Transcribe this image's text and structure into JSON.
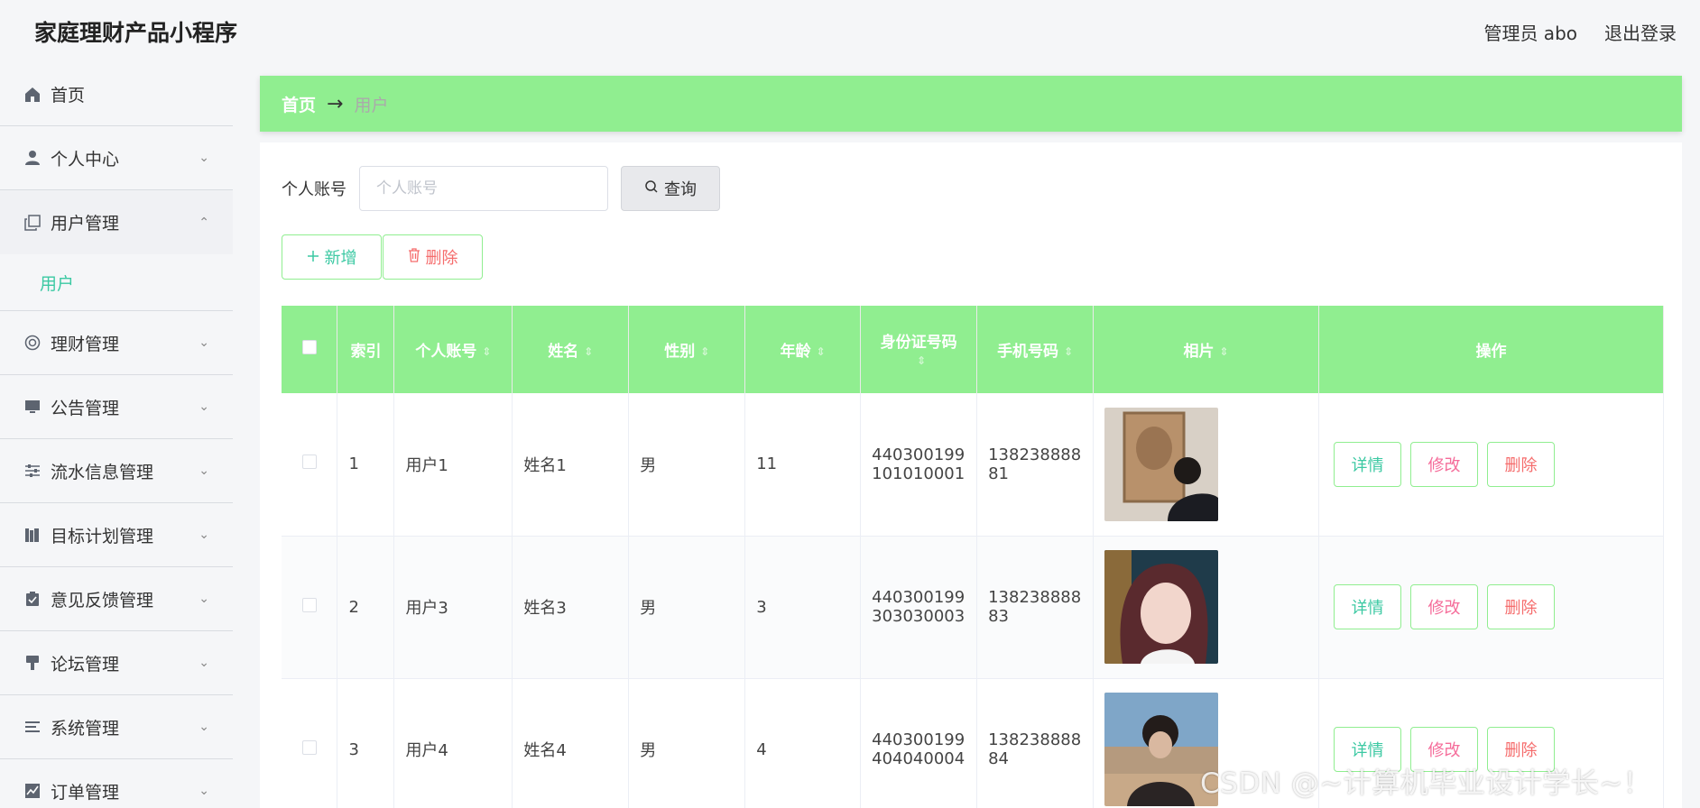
{
  "header": {
    "title": "家庭理财产品小程序",
    "user": "管理员 abo",
    "logout": "退出登录"
  },
  "sidebar": {
    "items": [
      {
        "label": "首页",
        "icon": "home-icon"
      },
      {
        "label": "个人中心",
        "icon": "user-icon"
      },
      {
        "label": "用户管理",
        "icon": "copy-icon"
      },
      {
        "label": "理财管理",
        "icon": "target-icon"
      },
      {
        "label": "公告管理",
        "icon": "monitor-icon"
      },
      {
        "label": "流水信息管理",
        "icon": "sliders-icon"
      },
      {
        "label": "目标计划管理",
        "icon": "books-icon"
      },
      {
        "label": "意见反馈管理",
        "icon": "clipboard-icon"
      },
      {
        "label": "论坛管理",
        "icon": "brush-icon"
      },
      {
        "label": "系统管理",
        "icon": "list-icon"
      },
      {
        "label": "订单管理",
        "icon": "chart-icon"
      }
    ],
    "submenu_user": "用户"
  },
  "breadcrumb": {
    "home": "首页",
    "arrow": "→",
    "current": "用户"
  },
  "search": {
    "label": "个人账号",
    "placeholder": "个人账号",
    "button": "查询"
  },
  "actions": {
    "add": "新增",
    "delete": "删除"
  },
  "table": {
    "columns": [
      "索引",
      "个人账号",
      "姓名",
      "性别",
      "年龄",
      "身份证号码",
      "手机号码",
      "相片",
      "操作"
    ],
    "rows": [
      {
        "index": "1",
        "account": "用户1",
        "name": "姓名1",
        "gender": "男",
        "age": "11",
        "id_line1": "440300199",
        "id_line2": "101010001",
        "phone_line1": "138238888",
        "phone_line2": "81"
      },
      {
        "index": "2",
        "account": "用户3",
        "name": "姓名3",
        "gender": "男",
        "age": "3",
        "id_line1": "440300199",
        "id_line2": "303030003",
        "phone_line1": "138238888",
        "phone_line2": "83"
      },
      {
        "index": "3",
        "account": "用户4",
        "name": "姓名4",
        "gender": "男",
        "age": "4",
        "id_line1": "440300199",
        "id_line2": "404040004",
        "phone_line1": "138238888",
        "phone_line2": "84"
      }
    ],
    "op_detail": "详情",
    "op_edit": "修改",
    "op_delete": "删除"
  },
  "watermark": "CSDN @~计算机毕业设计学长~！",
  "colors": {
    "accent_green": "#90ee90",
    "teal": "#3cc9a3",
    "danger": "#f56c6c"
  }
}
